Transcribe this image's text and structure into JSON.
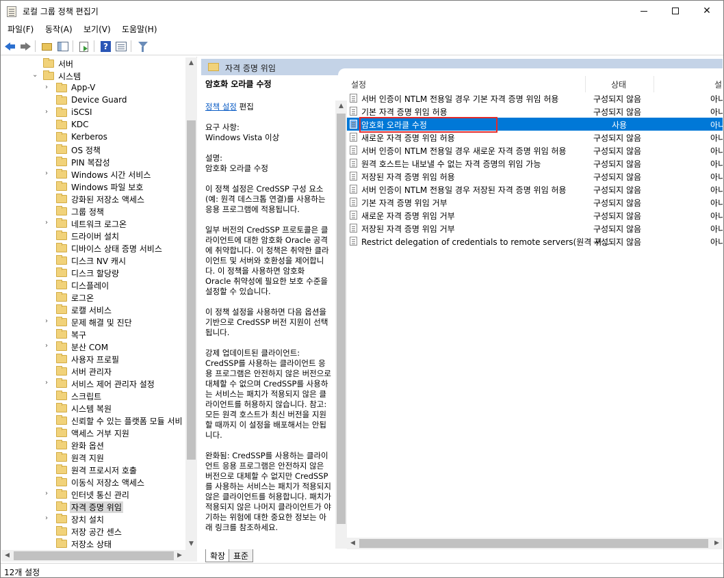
{
  "window": {
    "title": "로컬 그룹 정책 편집기"
  },
  "menu": [
    "파일(F)",
    "동작(A)",
    "보기(V)",
    "도움말(H)"
  ],
  "tree": {
    "items": [
      {
        "label": "서버",
        "chevron": ""
      },
      {
        "label": "시스템",
        "chevron": "⌄"
      },
      {
        "label": "App-V",
        "chevron": "›"
      },
      {
        "label": "Device Guard",
        "chevron": ""
      },
      {
        "label": "iSCSI",
        "chevron": "›"
      },
      {
        "label": "KDC",
        "chevron": ""
      },
      {
        "label": "Kerberos",
        "chevron": ""
      },
      {
        "label": "OS 정책",
        "chevron": ""
      },
      {
        "label": "PIN 복잡성",
        "chevron": ""
      },
      {
        "label": "Windows 시간 서비스",
        "chevron": "›"
      },
      {
        "label": "Windows 파일 보호",
        "chevron": ""
      },
      {
        "label": "강화된 저장소 액세스",
        "chevron": ""
      },
      {
        "label": "그룹 정책",
        "chevron": ""
      },
      {
        "label": "네트워크 로그온",
        "chevron": "›"
      },
      {
        "label": "드라이버 설치",
        "chevron": ""
      },
      {
        "label": "디바이스 상태 증명 서비스",
        "chevron": ""
      },
      {
        "label": "디스크 NV 캐시",
        "chevron": ""
      },
      {
        "label": "디스크 할당량",
        "chevron": ""
      },
      {
        "label": "디스플레이",
        "chevron": ""
      },
      {
        "label": "로그온",
        "chevron": ""
      },
      {
        "label": "로캘 서비스",
        "chevron": ""
      },
      {
        "label": "문제 해결 및 진단",
        "chevron": "›"
      },
      {
        "label": "복구",
        "chevron": ""
      },
      {
        "label": "분산 COM",
        "chevron": "›"
      },
      {
        "label": "사용자 프로필",
        "chevron": ""
      },
      {
        "label": "서버 관리자",
        "chevron": ""
      },
      {
        "label": "서비스 제어 관리자 설정",
        "chevron": "›"
      },
      {
        "label": "스크립트",
        "chevron": ""
      },
      {
        "label": "시스템 복원",
        "chevron": ""
      },
      {
        "label": "신뢰할 수 있는 플랫폼 모듈 서비",
        "chevron": ""
      },
      {
        "label": "액세스 거부 지원",
        "chevron": ""
      },
      {
        "label": "완화 옵션",
        "chevron": ""
      },
      {
        "label": "원격 지원",
        "chevron": ""
      },
      {
        "label": "원격 프로시저 호출",
        "chevron": ""
      },
      {
        "label": "이동식 저장소 액세스",
        "chevron": ""
      },
      {
        "label": "인터넷 통신 관리",
        "chevron": "›"
      },
      {
        "label": "자격 증명 위임",
        "chevron": ""
      },
      {
        "label": "장치 설치",
        "chevron": "›"
      },
      {
        "label": "저장 공간 센스",
        "chevron": ""
      },
      {
        "label": "저장소 상태",
        "chevron": ""
      }
    ]
  },
  "right_header": {
    "title": "자격 증명 위임"
  },
  "description": {
    "title": "암호화 오라클 수정",
    "edit_link": "정책 설정",
    "edit_suffix": " 편집",
    "requirements": "요구 사항:\nWindows Vista 이상",
    "desc": "설명:\n암호화 오라클 수정",
    "p1": "이 정책 설정은 CredSSP 구성 요소(예: 원격 데스크톱 연결)를 사용하는 응용 프로그램에 적용됩니다.",
    "p2": "일부 버전의 CredSSP 프로토콜은 클라이언트에 대한 암호화 Oracle 공격에 취약합니다. 이 정책은 취약한 클라이언트 및 서버와 호환성을 제어합니다. 이 정책을 사용하면 암호화 Oracle 취약성에 필요한 보호 수준을 설정할 수 있습니다.",
    "p3": "이 정책 설정을 사용하면 다음 옵션을 기반으로 CredSSP 버전 지원이 선택됩니다.",
    "p4": "강제 업데이트된 클라이언트: CredSSP를 사용하는 클라이언트 응용 프로그램은 안전하지 않은 버전으로 대체할 수 없으며 CredSSP를 사용하는 서비스는 패치가 적용되지 않은 클라이언트를 허용하지 않습니다. 참고: 모든 원격 호스트가 최신 버전을 지원할 때까지 이 설정을 배포해서는 안됩니다.",
    "p5": "완화됨: CredSSP를 사용하는 클라이언트 응용 프로그램은 안전하지 않은 버전으로 대체할 수 없지만 CredSSP를 사용하는 서비스는 패치가 적용되지 않은 클라이언트를 허용합니다. 패치가 적용되지 않은 나머지 클라이언트가 야기하는 위험에 대한 중요한 정보는 아래 링크를 참조하세요."
  },
  "columns": {
    "setting": "설정",
    "state": "상태",
    "comment": "설"
  },
  "rows": [
    {
      "name": "서버 인증이 NTLM 전용일 경우 기본 자격 증명 위임 허용",
      "state": "구성되지 않음",
      "comment": "아니"
    },
    {
      "name": "기본 자격 증명 위임 허용",
      "state": "구성되지 않음",
      "comment": "아니"
    },
    {
      "name": "암호화 오라클 수정",
      "state": "사용",
      "comment": "아니"
    },
    {
      "name": "새로운 자격 증명 위임 허용",
      "state": "구성되지 않음",
      "comment": "아니"
    },
    {
      "name": "서버 인증이 NTLM 전용일 경우 새로운 자격 증명 위임 허용",
      "state": "구성되지 않음",
      "comment": "아니"
    },
    {
      "name": "원격 호스트는 내보낼 수 없는 자격 증명의 위임 가능",
      "state": "구성되지 않음",
      "comment": "아니"
    },
    {
      "name": "저장된 자격 증명 위임 허용",
      "state": "구성되지 않음",
      "comment": "아니"
    },
    {
      "name": "서버 인증이 NTLM 전용일 경우 저장된 자격 증명 위임 허용",
      "state": "구성되지 않음",
      "comment": "아니"
    },
    {
      "name": "기본 자격 증명 위임 거부",
      "state": "구성되지 않음",
      "comment": "아니"
    },
    {
      "name": "새로운 자격 증명 위임 거부",
      "state": "구성되지 않음",
      "comment": "아니"
    },
    {
      "name": "저장된 자격 증명 위임 거부",
      "state": "구성되지 않음",
      "comment": "아니"
    },
    {
      "name": "Restrict delegation of credentials to remote servers(원격 서...",
      "state": "구성되지 않음",
      "comment": "아니"
    }
  ],
  "tabs": {
    "extended": "확장",
    "standard": "표준"
  },
  "status": {
    "text": "12개 설정"
  }
}
